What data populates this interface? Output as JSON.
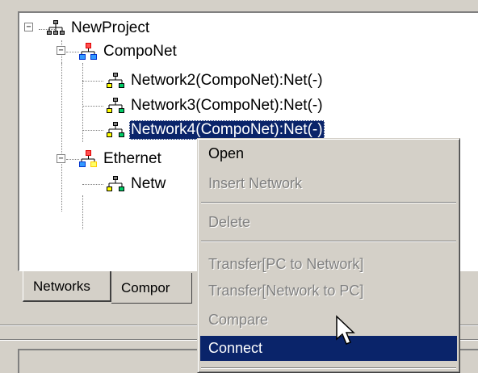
{
  "tree": {
    "root": {
      "label": "NewProject",
      "expander": "−"
    },
    "groups": [
      {
        "label": "CompoNet",
        "expander": "−",
        "children": [
          {
            "label": "Network2(CompoNet):Net(-)"
          },
          {
            "label": "Network3(CompoNet):Net(-)"
          },
          {
            "label": "Network4(CompoNet):Net(-)",
            "selected": true
          }
        ]
      },
      {
        "label": "Ethernet",
        "expander": "−",
        "children": [
          {
            "label": "Netw"
          }
        ]
      }
    ]
  },
  "tabs": [
    {
      "label": "Networks",
      "active": true
    },
    {
      "label": "Compor",
      "active": false
    }
  ],
  "context_menu": {
    "items": [
      {
        "label": "Open",
        "state": "enabled"
      },
      {
        "label": "Insert Network",
        "state": "disabled"
      },
      {
        "separator": true
      },
      {
        "label": "Delete",
        "state": "disabled"
      },
      {
        "separator": true
      },
      {
        "label": "Transfer[PC to Network]",
        "state": "disabled"
      },
      {
        "label": "Transfer[Network to PC]",
        "state": "disabled"
      },
      {
        "label": "Compare",
        "state": "disabled"
      },
      {
        "label": "Connect",
        "state": "highlighted"
      }
    ]
  },
  "colors": {
    "window_bg": "#d4d0c8",
    "selection_bg": "#0a246a",
    "disabled_text": "#808080"
  },
  "icons": {
    "root": "project-tree-icon",
    "group": "network-type-icon",
    "network": "network-node-icon",
    "cursor": "mouse-pointer-icon"
  }
}
